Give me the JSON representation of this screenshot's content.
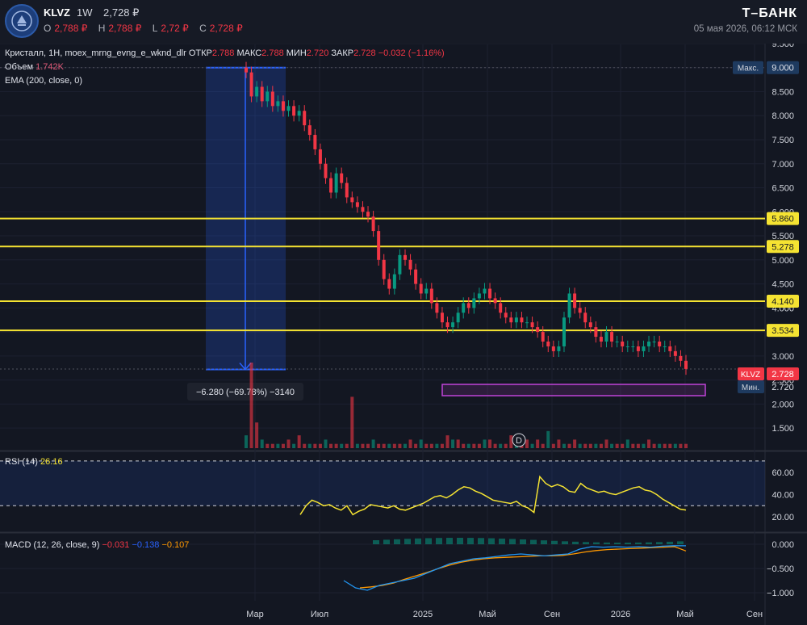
{
  "header": {
    "ticker": "KLVZ",
    "timeframe": "1W",
    "last_price": "2,728 ₽",
    "ohlc": [
      {
        "label": "O",
        "value": "2,788 ₽"
      },
      {
        "label": "H",
        "value": "2,788 ₽"
      },
      {
        "label": "L",
        "value": "2,72 ₽"
      },
      {
        "label": "C",
        "value": "2,728 ₽"
      }
    ],
    "brand": "Т–БАНК",
    "datetime": "05 мая 2026, 06:12 МСК"
  },
  "legend": {
    "series": "Кристалл, 1H, moex_mrng_evng_e_wknd_dlr",
    "open_label": "ОТКР",
    "open_value": "2.788",
    "high_label": "МАКС",
    "high_value": "2.788",
    "low_label": "МИН",
    "low_value": "2.720",
    "close_label": "ЗАКР",
    "close_value": "2.728",
    "change": "−0.032 (−1.16%)",
    "volume_label": "Объем",
    "volume_value": "1.742K",
    "ema_label": "EMA (200, close, 0)"
  },
  "rsi_legend": {
    "label": "RSI (14)",
    "value": "26.16"
  },
  "macd_legend": {
    "label": "MACD (12, 26, close, 9)",
    "v1": "−0.031",
    "v2": "−0.138",
    "v3": "−0.107"
  },
  "measure": {
    "label": "−6.280 (−69.78%) −3140"
  },
  "event_marker": "D",
  "colors": {
    "bull": "#089981",
    "bear": "#f23645",
    "level": "#f5e332",
    "rsi": "#f5e332",
    "macd": "#2196f3",
    "signal": "#ff9800",
    "measure": "#2962ff",
    "zone": "#c043d8"
  },
  "chart_data": {
    "type": "candlestick",
    "x_ticks": [
      "Мар",
      "Июл",
      "2025",
      "Май",
      "Сен",
      "2026",
      "Май",
      "Сен"
    ],
    "price_axis": {
      "ticks": [
        "9.500",
        "9.000",
        "8.500",
        "8.000",
        "7.500",
        "7.000",
        "6.500",
        "6.000",
        "5.500",
        "5.000",
        "4.500",
        "4.000",
        "3.500",
        "3.000",
        "2.500",
        "2.000",
        "1.500"
      ],
      "ylim": [
        1.2,
        9.6
      ]
    },
    "levels": [
      {
        "label": "5.860",
        "value": 5.86
      },
      {
        "label": "5.278",
        "value": 5.278
      },
      {
        "label": "4.140",
        "value": 4.14
      },
      {
        "label": "3.534",
        "value": 3.534
      }
    ],
    "max_label": {
      "label": "Макс.",
      "value": "9.000",
      "y": 9.0
    },
    "min_label": {
      "label": "Мин.",
      "value": "2.720",
      "y": 2.72
    },
    "last_label": {
      "label": "KLVZ",
      "value": "2.728",
      "y": 2.728
    },
    "closes": [
      8.9,
      8.4,
      8.6,
      8.3,
      8.5,
      8.2,
      8.3,
      8.1,
      8.2,
      8.0,
      8.1,
      7.8,
      7.6,
      7.3,
      7.0,
      6.7,
      6.4,
      6.8,
      6.6,
      6.3,
      6.2,
      6.1,
      6.0,
      5.9,
      5.6,
      5.0,
      4.6,
      4.4,
      4.7,
      5.1,
      5.0,
      4.8,
      4.5,
      4.3,
      4.4,
      4.1,
      3.9,
      3.7,
      3.6,
      3.7,
      3.9,
      4.1,
      4.0,
      4.2,
      4.3,
      4.4,
      4.2,
      4.1,
      3.9,
      3.8,
      3.7,
      3.8,
      3.7,
      3.7,
      3.6,
      3.5,
      3.3,
      3.2,
      3.1,
      3.2,
      3.8,
      4.3,
      4.0,
      3.9,
      3.7,
      3.6,
      3.4,
      3.3,
      3.5,
      3.3,
      3.3,
      3.2,
      3.2,
      3.2,
      3.1,
      3.2,
      3.3,
      3.3,
      3.2,
      3.2,
      3.1,
      3.0,
      2.9,
      2.73
    ],
    "rsi": {
      "ticks": [
        "60.00",
        "40.00",
        "20.00"
      ],
      "ylim": [
        10,
        75
      ],
      "bands": [
        70,
        30
      ],
      "values": [
        22,
        30,
        35,
        33,
        30,
        31,
        28,
        26,
        30,
        22,
        25,
        27,
        31,
        30,
        29,
        28,
        30,
        27,
        26,
        28,
        30,
        32,
        35,
        38,
        39,
        37,
        40,
        44,
        47,
        46,
        43,
        41,
        38,
        35,
        34,
        33,
        32,
        34,
        30,
        28,
        24,
        56,
        50,
        47,
        49,
        47,
        43,
        42,
        50,
        46,
        44,
        42,
        43,
        41,
        40,
        42,
        44,
        46,
        47,
        44,
        43,
        40,
        36,
        33,
        30,
        27,
        26.16
      ]
    },
    "macd": {
      "ticks": [
        "0.000",
        "−0.500",
        "−1.000"
      ],
      "ylim": [
        -1.1,
        0.15
      ],
      "macd": [
        -0.75,
        -0.9,
        -0.95,
        -0.85,
        -0.8,
        -0.75,
        -0.7,
        -0.6,
        -0.5,
        -0.4,
        -0.35,
        -0.3,
        -0.28,
        -0.25,
        -0.22,
        -0.2,
        -0.22,
        -0.24,
        -0.22,
        -0.2,
        -0.1,
        -0.05,
        -0.06,
        -0.05,
        -0.06,
        -0.05,
        -0.06,
        -0.04,
        -0.03,
        -0.031
      ],
      "signal": [
        -0.9,
        -0.88,
        -0.85,
        -0.8,
        -0.72,
        -0.65,
        -0.58,
        -0.5,
        -0.43,
        -0.37,
        -0.33,
        -0.3,
        -0.28,
        -0.27,
        -0.26,
        -0.25,
        -0.24,
        -0.24,
        -0.23,
        -0.2,
        -0.16,
        -0.13,
        -0.11,
        -0.1,
        -0.09,
        -0.08,
        -0.07,
        -0.06,
        -0.05,
        -0.138
      ]
    },
    "volume_bars": [
      3,
      20,
      6,
      2,
      1,
      1,
      1,
      1,
      2,
      1,
      3,
      1,
      1,
      1,
      1,
      2,
      1,
      1,
      1,
      1,
      12,
      1,
      1,
      1,
      2,
      1,
      1,
      1,
      1,
      1,
      1,
      2,
      1,
      2,
      1,
      1,
      1,
      1,
      3,
      2,
      2,
      1,
      1,
      1,
      1,
      2,
      2,
      1,
      1,
      1,
      3,
      1,
      2,
      2,
      1,
      2,
      1,
      4,
      1,
      2,
      1,
      1,
      2,
      1,
      1,
      1,
      1,
      1,
      2,
      1,
      1,
      1,
      2,
      1,
      1,
      1,
      2,
      1,
      1,
      1,
      1,
      1,
      1,
      1
    ]
  }
}
